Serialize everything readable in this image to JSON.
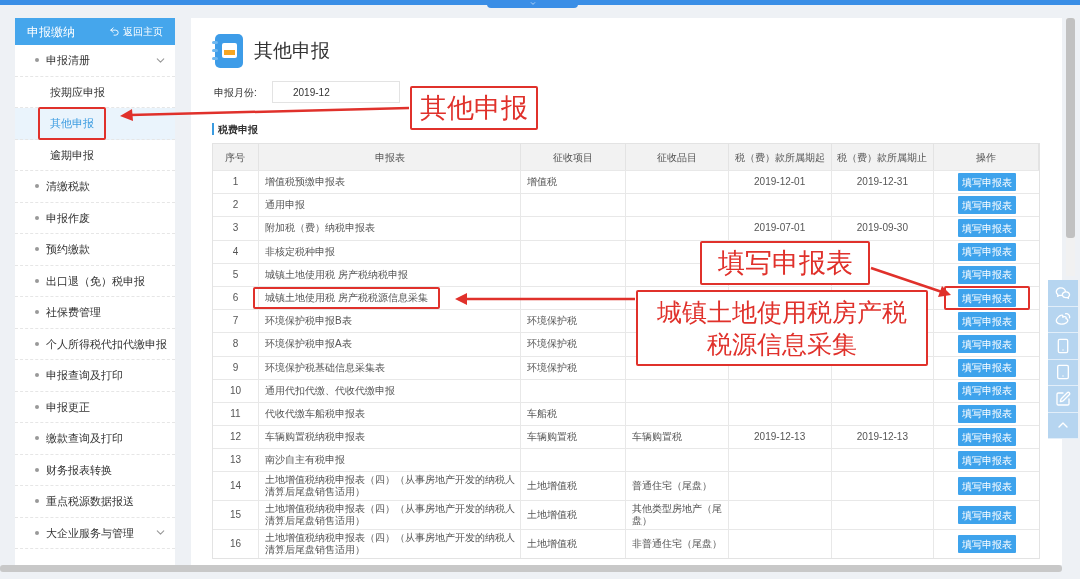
{
  "sidebar": {
    "title": "申报缴纳",
    "back_link": "返回主页",
    "items": [
      {
        "label": "申报清册",
        "has_submenu": true,
        "children": [
          {
            "label": "按期应申报",
            "selected": false,
            "marked": false
          },
          {
            "label": "其他申报",
            "selected": true,
            "marked": true
          },
          {
            "label": "逾期申报",
            "selected": false,
            "marked": false
          }
        ]
      },
      {
        "label": "清缴税款",
        "has_submenu": false
      },
      {
        "label": "申报作废",
        "has_submenu": false
      },
      {
        "label": "预约缴款",
        "has_submenu": false
      },
      {
        "label": "出口退（免）税申报",
        "has_submenu": false
      },
      {
        "label": "社保费管理",
        "has_submenu": false
      },
      {
        "label": "个人所得税代扣代缴申报",
        "has_submenu": false
      },
      {
        "label": "申报查询及打印",
        "has_submenu": false
      },
      {
        "label": "申报更正",
        "has_submenu": false
      },
      {
        "label": "缴款查询及打印",
        "has_submenu": false
      },
      {
        "label": "财务报表转换",
        "has_submenu": false
      },
      {
        "label": "重点税源数据报送",
        "has_submenu": false
      },
      {
        "label": "大企业服务与管理",
        "has_submenu": true
      }
    ]
  },
  "page": {
    "title": "其他申报",
    "month_field": {
      "label": "申报月份:",
      "value": "2019-12"
    },
    "section_title": "税费申报"
  },
  "table": {
    "columns": [
      "序号",
      "申报表",
      "征收项目",
      "征收品目",
      "税（费）款所属期起",
      "税（费）款所属期止",
      "操作"
    ],
    "rows": [
      {
        "no": "1",
        "form": "增值税预缴申报表",
        "item": "增值税",
        "subitem": "",
        "start": "2019-12-01",
        "end": "2019-12-31",
        "action": "填写申报表",
        "marked": false
      },
      {
        "no": "2",
        "form": "通用申报",
        "item": "",
        "subitem": "",
        "start": "",
        "end": "",
        "action": "填写申报表",
        "marked": false
      },
      {
        "no": "3",
        "form": "附加税（费）纳税申报表",
        "item": "",
        "subitem": "",
        "start": "2019-07-01",
        "end": "2019-09-30",
        "action": "填写申报表",
        "marked": false
      },
      {
        "no": "4",
        "form": "非核定税种申报",
        "item": "",
        "subitem": "",
        "start": "",
        "end": "",
        "action": "填写申报表",
        "marked": false
      },
      {
        "no": "5",
        "form": "城镇土地使用税 房产税纳税申报",
        "item": "",
        "subitem": "",
        "start": "",
        "end": "",
        "action": "填写申报表",
        "marked": false
      },
      {
        "no": "6",
        "form": "城镇土地使用税 房产税税源信息采集",
        "item": "",
        "subitem": "",
        "start": "",
        "end": "",
        "action": "填写申报表",
        "marked": true
      },
      {
        "no": "7",
        "form": "环境保护税申报B表",
        "item": "环境保护税",
        "subitem": "",
        "start": "",
        "end": "",
        "action": "填写申报表",
        "marked": false
      },
      {
        "no": "8",
        "form": "环境保护税申报A表",
        "item": "环境保护税",
        "subitem": "",
        "start": "",
        "end": "",
        "action": "填写申报表",
        "marked": false
      },
      {
        "no": "9",
        "form": "环境保护税基础信息采集表",
        "item": "环境保护税",
        "subitem": "",
        "start": "",
        "end": "",
        "action": "填写申报表",
        "marked": false
      },
      {
        "no": "10",
        "form": "通用代扣代缴、代收代缴申报",
        "item": "",
        "subitem": "",
        "start": "",
        "end": "",
        "action": "填写申报表",
        "marked": false
      },
      {
        "no": "11",
        "form": "代收代缴车船税申报表",
        "item": "车船税",
        "subitem": "",
        "start": "",
        "end": "",
        "action": "填写申报表",
        "marked": false
      },
      {
        "no": "12",
        "form": "车辆购置税纳税申报表",
        "item": "车辆购置税",
        "subitem": "车辆购置税",
        "start": "2019-12-13",
        "end": "2019-12-13",
        "action": "填写申报表",
        "marked": false
      },
      {
        "no": "13",
        "form": "南沙自主有税申报",
        "item": "",
        "subitem": "",
        "start": "",
        "end": "",
        "action": "填写申报表",
        "marked": false
      },
      {
        "no": "14",
        "form": "土地增值税纳税申报表（四）（从事房地产开发的纳税人清算后尾盘销售适用）",
        "item": "土地增值税",
        "subitem": "普通住宅（尾盘）",
        "start": "",
        "end": "",
        "action": "填写申报表",
        "marked": false
      },
      {
        "no": "15",
        "form": "土地增值税纳税申报表（四）（从事房地产开发的纳税人清算后尾盘销售适用）",
        "item": "土地增值税",
        "subitem": "其他类型房地产（尾盘）",
        "start": "",
        "end": "",
        "action": "填写申报表",
        "marked": false
      },
      {
        "no": "16",
        "form": "土地增值税纳税申报表（四）（从事房地产开发的纳税人清算后尾盘销售适用）",
        "item": "土地增值税",
        "subitem": "非普通住宅（尾盘）",
        "start": "",
        "end": "",
        "action": "填写申报表",
        "marked": false
      }
    ]
  },
  "annotations": [
    {
      "text": "其他申报"
    },
    {
      "text": "填写申报表"
    },
    {
      "text": "城镇土地使用税房产税税源信息采集"
    }
  ]
}
